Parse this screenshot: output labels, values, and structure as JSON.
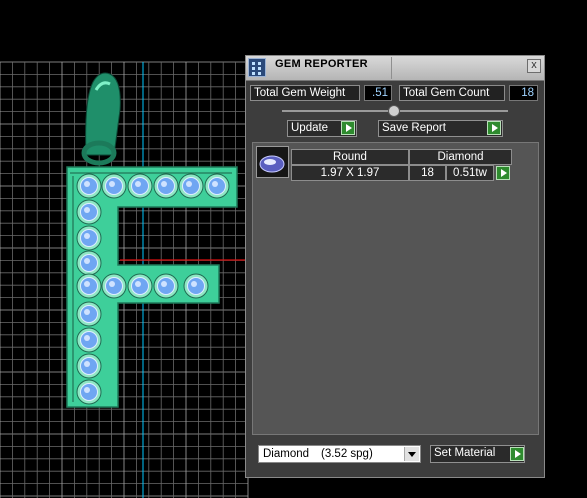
{
  "panel": {
    "title": "GEM REPORTER",
    "close_label": "x",
    "total_weight_label": "Total Gem Weight",
    "total_weight_value": ".51",
    "total_count_label": "Total Gem Count",
    "total_count_value": "18",
    "update_label": "Update",
    "save_report_label": "Save Report",
    "headers": {
      "shape": "Round",
      "material": "Diamond"
    },
    "rows": [
      {
        "size": "1.97 X 1.97",
        "count": "18",
        "weight": "0.51tw"
      }
    ],
    "material_select": {
      "name": "Diamond",
      "spg": "(3.52 spg)"
    },
    "set_material_label": "Set Material"
  },
  "colors": {
    "accent_green": "#2e8b2e",
    "pendant_green": "#3ccf9a",
    "value_text": "#9fd3ff"
  }
}
